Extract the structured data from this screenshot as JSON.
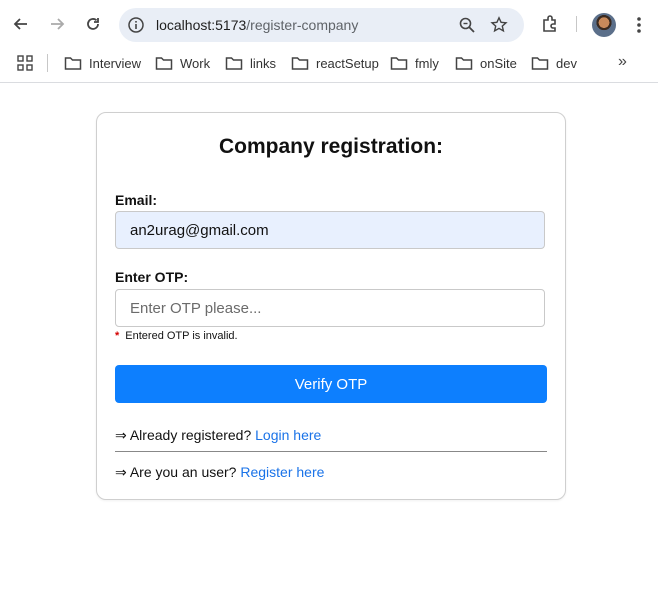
{
  "browser": {
    "url_host": "localhost:5173",
    "url_path": "/register-company",
    "icons": {
      "back": "arrow-left-icon",
      "forward": "arrow-right-icon",
      "reload": "reload-icon",
      "site_info": "info-icon",
      "zoom": "zoom-icon",
      "bookmark": "star-icon",
      "extensions": "puzzle-icon",
      "menu": "kebab-menu-icon"
    }
  },
  "bookmarks": {
    "items": [
      {
        "label": "Interview"
      },
      {
        "label": "Work"
      },
      {
        "label": "links"
      },
      {
        "label": "reactSetup"
      },
      {
        "label": "fmly"
      },
      {
        "label": "onSite"
      },
      {
        "label": "dev"
      }
    ],
    "more_label": "»"
  },
  "form": {
    "title": "Company registration:",
    "email_label": "Email:",
    "email_value": "an2urag@gmail.com",
    "otp_label": "Enter OTP:",
    "otp_placeholder": "Enter OTP please...",
    "otp_value": "",
    "error_marker": "*",
    "error_text": "Entered OTP is invalid.",
    "verify_label": "Verify OTP",
    "already_prefix": "⇒ Already registered?",
    "login_link": "Login here",
    "user_prefix": "⇒ Are you an user?",
    "register_link": "Register here"
  },
  "colors": {
    "primary": "#0d7ffe",
    "link": "#1a73e8",
    "error": "#d40000",
    "autofill": "#e8f0fe"
  }
}
